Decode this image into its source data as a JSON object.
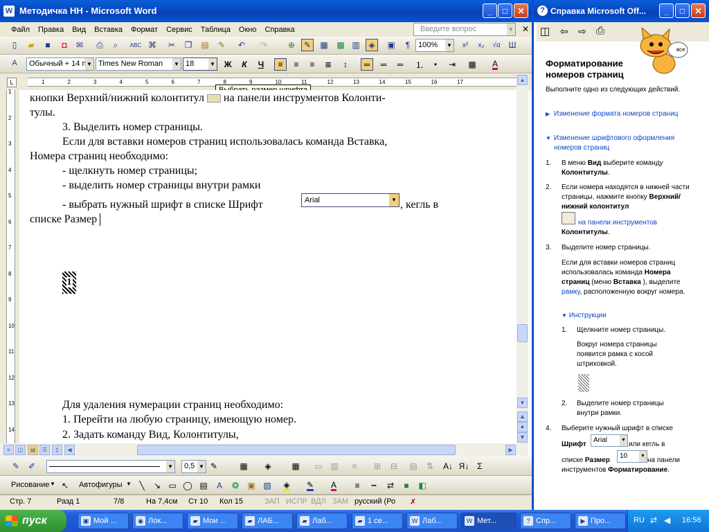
{
  "word": {
    "title": "Методичка НН - Microsoft Word",
    "menu": [
      "Файл",
      "Правка",
      "Вид",
      "Вставка",
      "Формат",
      "Сервис",
      "Таблица",
      "Окно",
      "Справка"
    ],
    "ask_placeholder": "Введите вопрос",
    "zoom": "100%",
    "style": "Обычный + 14 п",
    "font": "Times New Roman",
    "size": "18",
    "tooltip": "Выбрать размер шрифта",
    "doc_lines": [
      "кнопки Верхний/нижний колонтитул",
      "на панели инструментов Колонти-",
      "тулы.",
      "3. Выделить номер страницы.",
      "Если для вставки номеров страниц использовалась команда Вставка,",
      "Номера страниц необходимо:",
      "- щелкнуть номер страницы;",
      "- выделить номер страницы внутри рамки",
      "- выбрать нужный шрифт в списке Шрифт",
      ", кегль в",
      "списке Размер",
      "Для удаления нумерации страниц необходимо:",
      "1. Перейти на любую страницу, имеющую номер.",
      "2. Задать команду Вид, Колонтитулы,"
    ],
    "inline_font_combo": "Arial",
    "page_number_frame": "1",
    "drawing_toolbar": {
      "drawing": "Рисование",
      "autoshapes": "Автофигуры",
      "line_weight": "0,5"
    },
    "status": {
      "page": "Стр. 7",
      "section": "Разд 1",
      "pages": "7/8",
      "at": "На 7,4см",
      "line": "Ст 10",
      "col": "Кол 15",
      "rec": "ЗАП",
      "trk": "ИСПР",
      "ext": "ВДЛ",
      "ovr": "ЗАМ",
      "lang": "русский (Ро"
    },
    "ruler_numbers_h": [
      "1",
      "2",
      "3",
      "4",
      "5",
      "6",
      "7",
      "8",
      "9",
      "10",
      "11",
      "12",
      "13",
      "14",
      "15",
      "16",
      "17"
    ],
    "ruler_numbers_v": [
      "1",
      "2",
      "3",
      "4",
      "5",
      "6",
      "7",
      "8",
      "9",
      "10",
      "11",
      "12",
      "13",
      "14"
    ]
  },
  "help": {
    "title": "Справка Microsoft Off...",
    "heading": "Форматирование номеров страниц",
    "intro": "Выполните одно из следующих действий.",
    "link1": "Изменение формата номеров страниц",
    "link2": "Изменение шрифтового оформления номеров страниц",
    "assistant_label": "все",
    "steps": {
      "s1_num": "1.",
      "s1_a": "В меню ",
      "s1_b": "Вид",
      "s1_c": " выберите команду",
      "s1_d": "Колонтитулы",
      "s1_e": ".",
      "s2_num": "2.",
      "s2_a": "Если номера находятся в нижней части страницы, нажмите кнопку",
      "s2_b": "Верхний/нижний колонтитул",
      "s2_c": "на панели инструментов",
      "s2_d": "Колонтитулы",
      "s2_e": ".",
      "s3_num": "3.",
      "s3": "Выделите номер страницы.",
      "s3_note_a": "Если для вставки номеров страниц использовалась команда",
      "s3_note_b": "Номера страниц",
      "s3_note_c": " (меню ",
      "s3_note_d": "Вставка",
      "s3_note_e": " ), выделите ",
      "s3_note_f": "рамку",
      "s3_note_g": ", расположенную вокруг номера.",
      "instructions": "Инструкции",
      "i1_num": "1.",
      "i1": "Щелкните номер страницы.",
      "i1_note": "Вокруг номера страницы появится рамка с косой штриховкой.",
      "i2_num": "2.",
      "i2": "Выделите номер страницы внутри рамки.",
      "s4_num": "4.",
      "s4_a": "Выберите нужный шрифт в списке",
      "s4_b": "Шрифт",
      "s4_font": "Arial",
      "s4_c": " или кегль в",
      "s4_d": "списке ",
      "s4_e": "Размер",
      "s4_size": "10",
      "s4_f": " на панели",
      "s4_g": "инструментов ",
      "s4_h": "Форматирование",
      "s4_i": "."
    }
  },
  "taskbar": {
    "start": "пуск",
    "tasks": [
      "Мой ...",
      "Лок...",
      "Мои ...",
      "ЛАБ...",
      "Лаб...",
      "1 се...",
      "Лаб...",
      "Мет...",
      "Спр...",
      "Про..."
    ],
    "lang": "RU",
    "clock": "16:56"
  }
}
